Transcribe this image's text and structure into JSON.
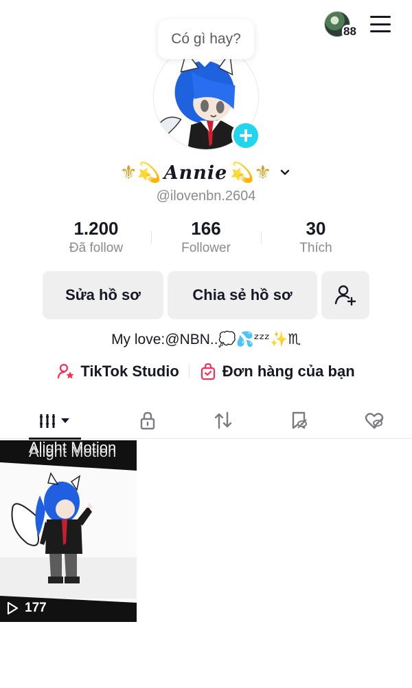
{
  "topbar": {
    "notification_count": "88",
    "avatar_icon": "account-switcher-avatar",
    "menu_icon": "hamburger-menu-icon"
  },
  "profile": {
    "bubble_text": "Có gì hay?",
    "name_prefix": "⚜💫",
    "name": "Annie",
    "name_suffix": "💫⚜",
    "username": "@ilovenbn.2604"
  },
  "stats": [
    {
      "value": "1.200",
      "label": "Đã follow"
    },
    {
      "value": "166",
      "label": "Follower"
    },
    {
      "value": "30",
      "label": "Thích"
    }
  ],
  "actions": {
    "edit_profile": "Sửa hồ sơ",
    "share_profile": "Chia sẻ hồ sơ"
  },
  "bio": {
    "text": "My love:@NBN..",
    "emojis": "💭💦ᶻᶻᶻ✨♏"
  },
  "links": {
    "studio": "TikTok Studio",
    "orders": "Đơn hàng của bạn"
  },
  "tabs": [
    "videos",
    "private",
    "reposts",
    "favorites",
    "liked"
  ],
  "videos": [
    {
      "watermark": "Alight Motion",
      "views": "177"
    }
  ],
  "colors": {
    "accent_teal": "#20d5ec",
    "accent_red": "#fe2c55",
    "text": "#161823",
    "muted": "#8a8b91",
    "button_bg": "#efeff0"
  }
}
